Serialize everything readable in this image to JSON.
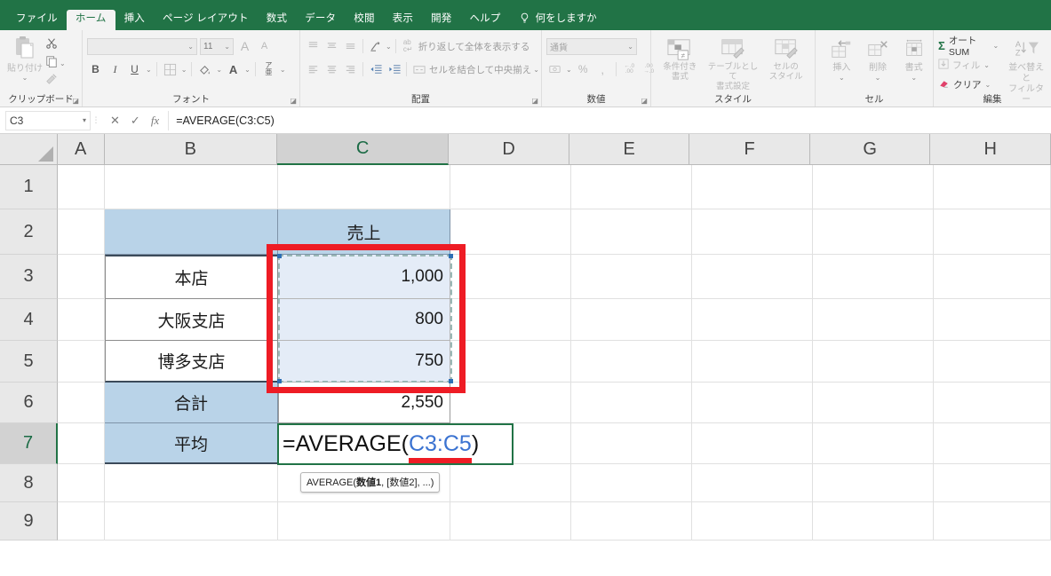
{
  "app": {
    "tabs": [
      {
        "label": "ファイル",
        "active": false
      },
      {
        "label": "ホーム",
        "active": true
      },
      {
        "label": "挿入",
        "active": false
      },
      {
        "label": "ページ レイアウト",
        "active": false
      },
      {
        "label": "数式",
        "active": false
      },
      {
        "label": "データ",
        "active": false
      },
      {
        "label": "校閲",
        "active": false
      },
      {
        "label": "表示",
        "active": false
      },
      {
        "label": "開発",
        "active": false
      },
      {
        "label": "ヘルプ",
        "active": false
      }
    ],
    "tell_me": "何をしますか",
    "accent_color": "#217346"
  },
  "ribbon": {
    "clipboard": {
      "label": "クリップボード",
      "paste_label": "貼り付け",
      "cut_icon": "scissors-icon",
      "copy_icon": "copy-icon",
      "format_painter_icon": "format-painter-icon"
    },
    "font": {
      "label": "フォント",
      "font_name": "",
      "font_size": "11",
      "bold": "B",
      "italic": "I",
      "underline": "U",
      "grow_font": "A",
      "shrink_font": "A",
      "borders_icon": "borders-icon",
      "fill_color_icon": "fill-color-icon",
      "font_color_label": "A",
      "phonetic_label": "ア亜"
    },
    "alignment": {
      "label": "配置",
      "wrap_text": "折り返して全体を表示する",
      "merge_center": "セルを結合して中央揃え",
      "orientation_icon": "orientation-icon",
      "decrease_indent_icon": "decrease-indent-icon",
      "increase_indent_icon": "increase-indent-icon"
    },
    "number": {
      "label": "数値",
      "format_value": "通貨",
      "currency_icon": "currency-icon",
      "percent": "%",
      "comma": ",",
      "increase_decimal": "←.0\n.00",
      "decrease_decimal": ".00\n→.0"
    },
    "styles": {
      "label": "スタイル",
      "conditional": "条件付き\n書式",
      "conditional_l1": "条件付き",
      "conditional_l2": "書式",
      "table_l1": "テーブルとして",
      "table_l2": "書式設定",
      "cellstyle_l1": "セルの",
      "cellstyle_l2": "スタイル"
    },
    "cells": {
      "label": "セル",
      "insert": "挿入",
      "delete": "削除",
      "format": "書式"
    },
    "editing": {
      "label": "編集",
      "autosum": "オート SUM",
      "fill": "フィル",
      "clear": "クリア",
      "sort_l1": "並べ替えと",
      "sort_l2": "フィルター"
    }
  },
  "formula_bar": {
    "name_box_value": "C3",
    "cancel_icon": "cancel-icon",
    "enter_icon": "enter-check-icon",
    "function_icon": "insert-function-icon",
    "formula_value": "=AVERAGE(C3:C5)"
  },
  "grid": {
    "columns": [
      "A",
      "B",
      "C",
      "D",
      "E",
      "F",
      "G",
      "H"
    ],
    "selected_column": "C",
    "rows": [
      "1",
      "2",
      "3",
      "4",
      "5",
      "6",
      "7",
      "8",
      "9"
    ],
    "selected_row": "7",
    "cells": {
      "C2": "売上",
      "B3": "本店",
      "C3": "1,000",
      "B4": "大阪支店",
      "C4": "800",
      "B5": "博多支店",
      "C5": "750",
      "B6": "合計",
      "C6": "2,550",
      "B7": "平均"
    },
    "editing_cell": {
      "address": "C7",
      "prefix": "=AVERAGE(",
      "reference": "C3:C5",
      "suffix": ")"
    },
    "tooltip": {
      "fn": "AVERAGE(",
      "arg1": "数値1",
      "rest": ", [数値2], ...)"
    },
    "selection_range": "C3:C5",
    "annotation_color": "#ee1c25",
    "header_fill_color": "#b9d3e8",
    "selection_fill_color": "#e4ecf7"
  }
}
